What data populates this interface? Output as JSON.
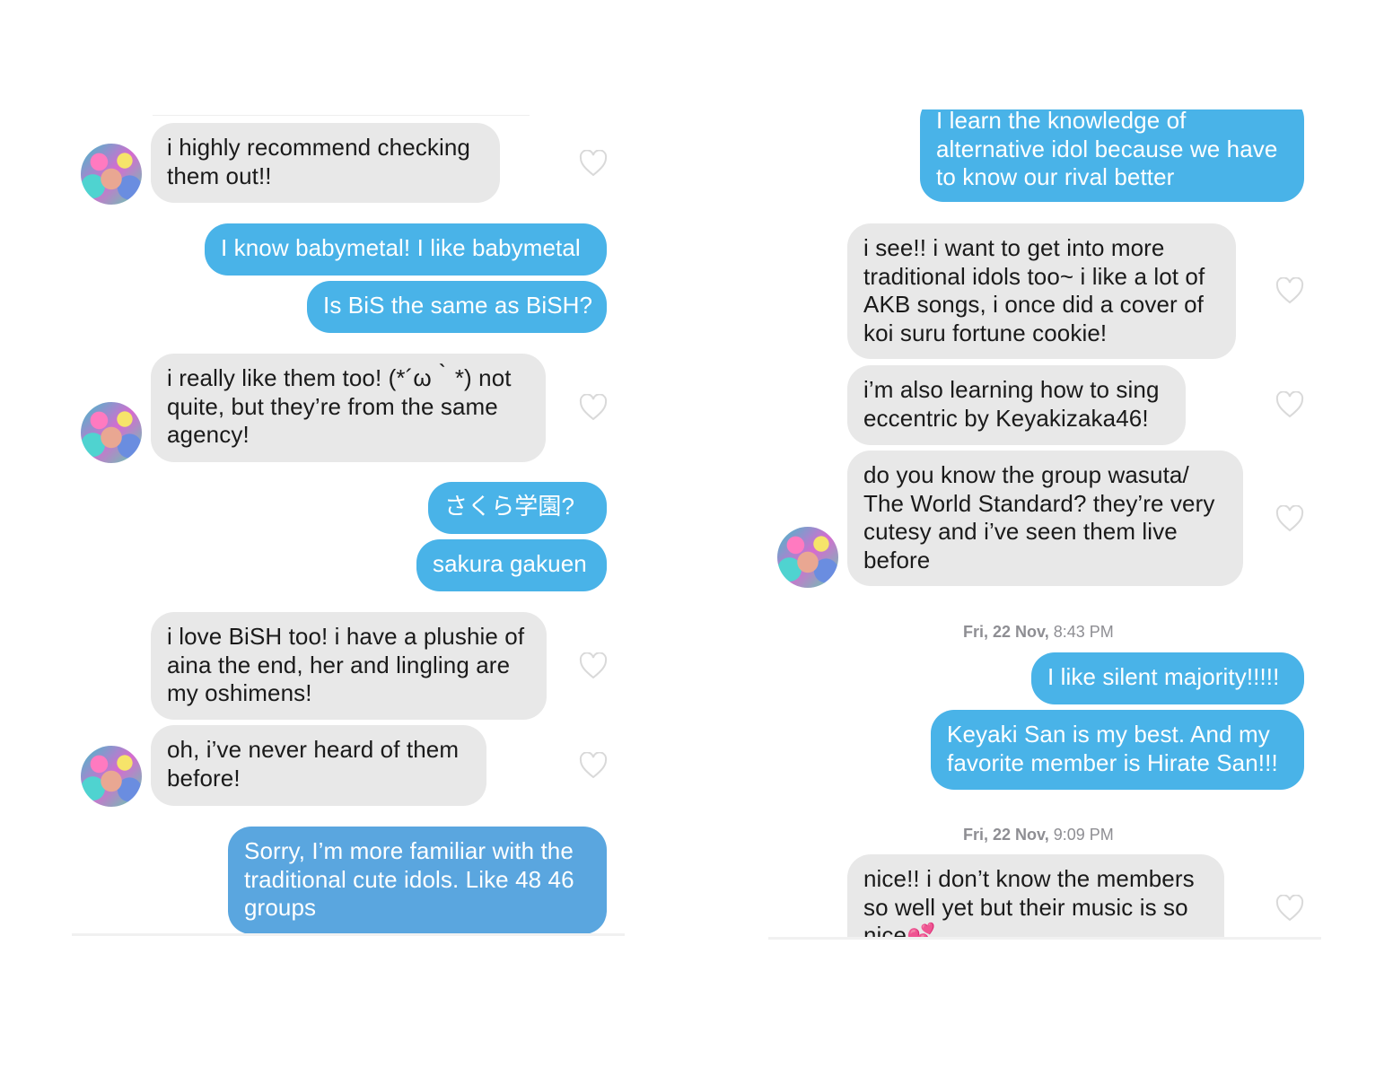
{
  "left_panel": {
    "messages": [
      {
        "id": "l1",
        "text": "i highly recommend checking\nthem out!!"
      },
      {
        "id": "l2",
        "text": "I know babymetal! I like babymetal"
      },
      {
        "id": "l3",
        "text": "Is BiS the same as BiSH?"
      },
      {
        "id": "l4",
        "text": "i really like them too! (*´ω｀*) not\nquite, but they’re from the same\nagency!"
      },
      {
        "id": "l5",
        "text": "さくら学園?"
      },
      {
        "id": "l6",
        "text": "sakura gakuen"
      },
      {
        "id": "l7",
        "text": "i love BiSH too! i have a plushie of\naina the end, her and lingling are\nmy oshimens!"
      },
      {
        "id": "l8",
        "text": "oh, i’ve never heard of them\nbefore!"
      },
      {
        "id": "l9",
        "text": "Sorry, I’m more familiar with the\ntraditional cute idols. Like 48 46\ngroups"
      }
    ]
  },
  "right_panel": {
    "messages": [
      {
        "id": "r1",
        "text": "I learn the knowledge of\nalternative idol because we have\nto know our rival better"
      },
      {
        "id": "r2",
        "text": "i see!! i want to get into more\ntraditional idols too~ i like a lot of\nAKB songs, i once did a cover of\nkoi suru fortune cookie!"
      },
      {
        "id": "r3",
        "text": "i’m also learning how to sing\neccentric by Keyakizaka46!"
      },
      {
        "id": "r4",
        "text": "do you know the group wasuta/\nThe World Standard? they’re very\ncutesy and i’ve seen them live\nbefore"
      },
      {
        "id": "r5",
        "text": "I like silent majority!!!!!"
      },
      {
        "id": "r6",
        "text": "Keyaki San is my best. And my\nfavorite member is Hirate San!!!"
      },
      {
        "id": "r7",
        "text": "nice!! i don’t know the members\nso well yet but their music is so\nnice💕"
      }
    ],
    "timestamps": [
      {
        "day": "Fri, 22 Nov,",
        "time": "8:43 PM"
      },
      {
        "day": "Fri, 22 Nov,",
        "time": "9:09 PM"
      }
    ]
  },
  "icons": {
    "like": "heart-outline-icon",
    "avatar": "user-avatar"
  },
  "colors": {
    "sent_bubble": "#49b3e8",
    "received_bubble": "#e8e8e8",
    "heart": "#d9d9d9"
  }
}
